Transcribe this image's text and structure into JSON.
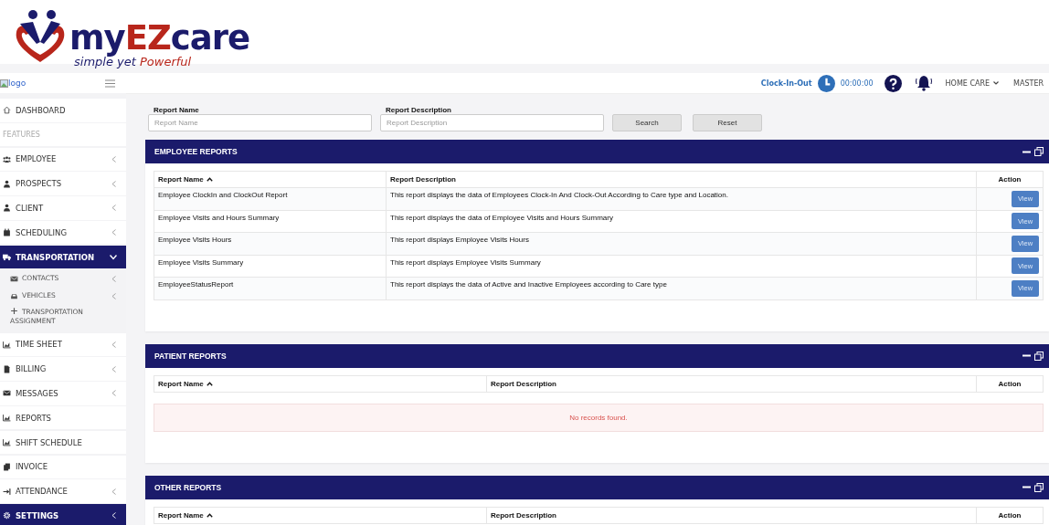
{
  "brand": {
    "name_parts": [
      {
        "text": "my",
        "accent": false
      },
      {
        "text": "EZ",
        "accent": true
      },
      {
        "text": "care",
        "accent": false
      }
    ],
    "tagline_parts": [
      {
        "text": "simple yet",
        "accent": false
      },
      {
        "text": "Powerful",
        "accent": true
      }
    ]
  },
  "broken_logo": {
    "alt": "logo"
  },
  "topbar": {
    "clock_label": "Clock-In-Out",
    "timer": "00:00:00",
    "agency": "HOME CARE",
    "user": "MASTER"
  },
  "sidebar": {
    "items": [
      {
        "kind": "link",
        "label": "DASHBOARD",
        "selected": false
      },
      {
        "kind": "section",
        "label": "FEATURES"
      },
      {
        "kind": "group",
        "label": "EMPLOYEE",
        "expanded": false,
        "selected": false
      },
      {
        "kind": "group",
        "label": "PROSPECTS",
        "expanded": false,
        "selected": false
      },
      {
        "kind": "group",
        "label": "CLIENT",
        "expanded": false,
        "selected": false
      },
      {
        "kind": "group",
        "label": "SCHEDULING",
        "expanded": false,
        "selected": false
      },
      {
        "kind": "group",
        "label": "TRANSPORTATION",
        "expanded": true,
        "selected": true
      },
      {
        "kind": "subgroup",
        "label": "CONTACTS",
        "expanded": false,
        "selected": false
      },
      {
        "kind": "subgroup",
        "label": "VEHICLES",
        "expanded": false,
        "selected": false
      },
      {
        "kind": "sublink",
        "label": "TRANSPORTATION ASSIGNMENT",
        "selected": false
      },
      {
        "kind": "group",
        "label": "TIME SHEET",
        "expanded": false,
        "selected": false
      },
      {
        "kind": "group",
        "label": "BILLING",
        "expanded": false,
        "selected": false
      },
      {
        "kind": "group",
        "label": "MESSAGES",
        "expanded": false,
        "selected": false
      },
      {
        "kind": "link",
        "label": "REPORTS",
        "selected": false
      },
      {
        "kind": "link",
        "label": "SHIFT SCHEDULE",
        "selected": false
      },
      {
        "kind": "link",
        "label": "INVOICE",
        "selected": false
      },
      {
        "kind": "group",
        "label": "ATTENDANCE",
        "expanded": false,
        "selected": false
      },
      {
        "kind": "group",
        "label": "SETTINGS",
        "expanded": false,
        "selected": true
      }
    ]
  },
  "filters": {
    "fields": [
      {
        "label": "Report Name",
        "placeholder": "Report Name"
      },
      {
        "label": "Report Description",
        "placeholder": "Report Description"
      }
    ],
    "buttons": [
      "Search",
      "Reset"
    ]
  },
  "panels": [
    {
      "title": "EMPLOYEE REPORTS",
      "columns": [
        {
          "label": "Report Name",
          "sorted": true
        },
        {
          "label": "Report Description",
          "sorted": false
        },
        {
          "label": "Action",
          "sorted": false
        }
      ],
      "rows": [
        {
          "name": "Employee ClockIn and ClockOut Report",
          "description": "This report displays the data of Employees Clock-In And Clock-Out According to Care type and Location.",
          "action": "View"
        },
        {
          "name": "Employee Visits and Hours Summary",
          "description": "This report displays the data of Employee Visits and Hours Summary",
          "action": "View"
        },
        {
          "name": "Employee Visits Hours",
          "description": "This report displays Employee Visits Hours",
          "action": "View"
        },
        {
          "name": "Employee Visits Summary",
          "description": "This report displays Employee Visits Summary",
          "action": "View"
        },
        {
          "name": "EmployeeStatusReport",
          "description": "This report displays the data of Active and Inactive Employees according to Care type",
          "action": "View"
        }
      ]
    },
    {
      "title": "PATIENT REPORTS",
      "columns": [
        {
          "label": "Report Name",
          "sorted": true
        },
        {
          "label": "Report Description",
          "sorted": false
        },
        {
          "label": "Action",
          "sorted": false
        }
      ],
      "empty_message": "No records found."
    },
    {
      "title": "OTHER REPORTS",
      "columns": [
        {
          "label": "Report Name",
          "sorted": true
        },
        {
          "label": "Report Description",
          "sorted": false
        },
        {
          "label": "Action",
          "sorted": false
        }
      ]
    }
  ]
}
